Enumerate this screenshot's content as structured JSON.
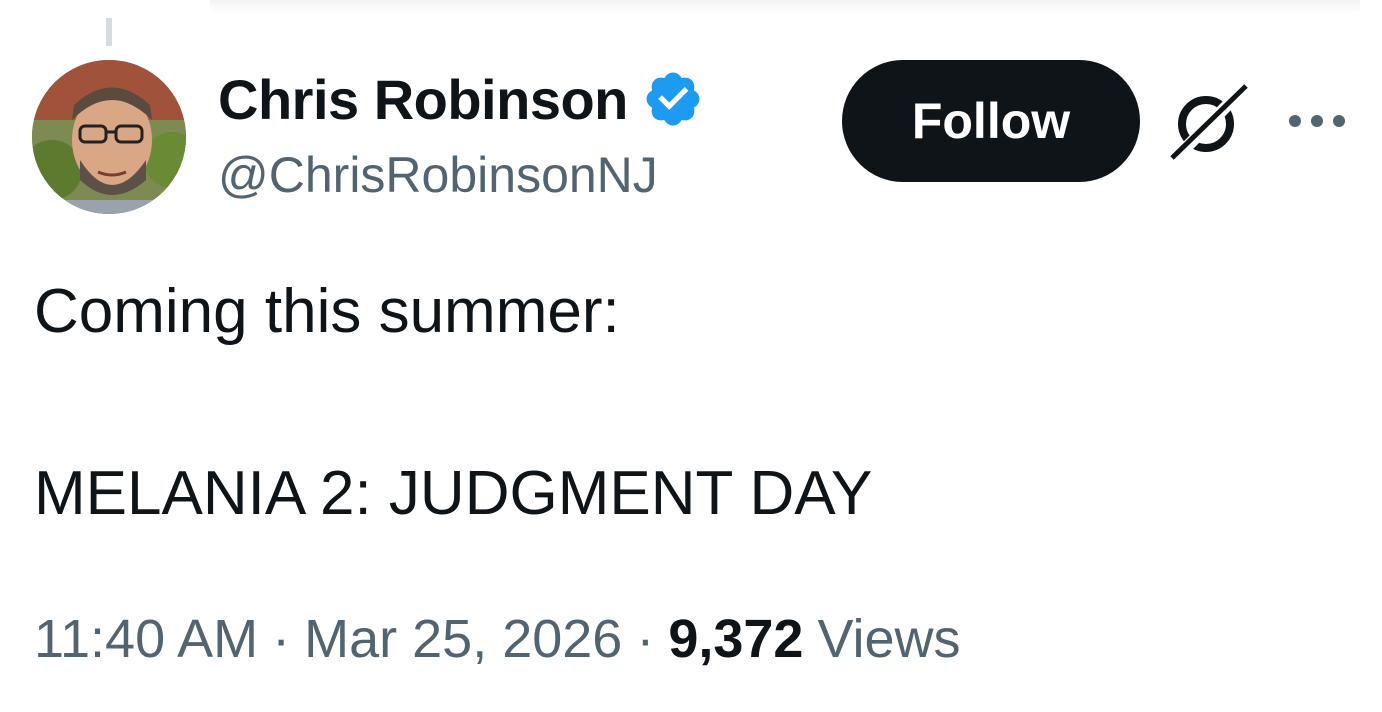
{
  "author": {
    "display_name": "Chris Robinson",
    "handle": "@ChrisRobinsonNJ",
    "verified": true
  },
  "actions": {
    "follow_label": "Follow"
  },
  "tweet": {
    "line1": "Coming this summer:",
    "line2": "MELANIA 2: JUDGMENT DAY"
  },
  "meta": {
    "time": "11:40 AM",
    "separator": "·",
    "date": "Mar 25, 2026",
    "views_count": "9,372",
    "views_label": "Views"
  },
  "icons": {
    "verified": "verified-badge-icon",
    "grok": "grok-icon",
    "more": "more-options-icon"
  },
  "colors": {
    "primary_text": "#0f1419",
    "secondary_text": "#536471",
    "verified_blue": "#1d9bf0",
    "follow_bg": "#0f1419"
  }
}
